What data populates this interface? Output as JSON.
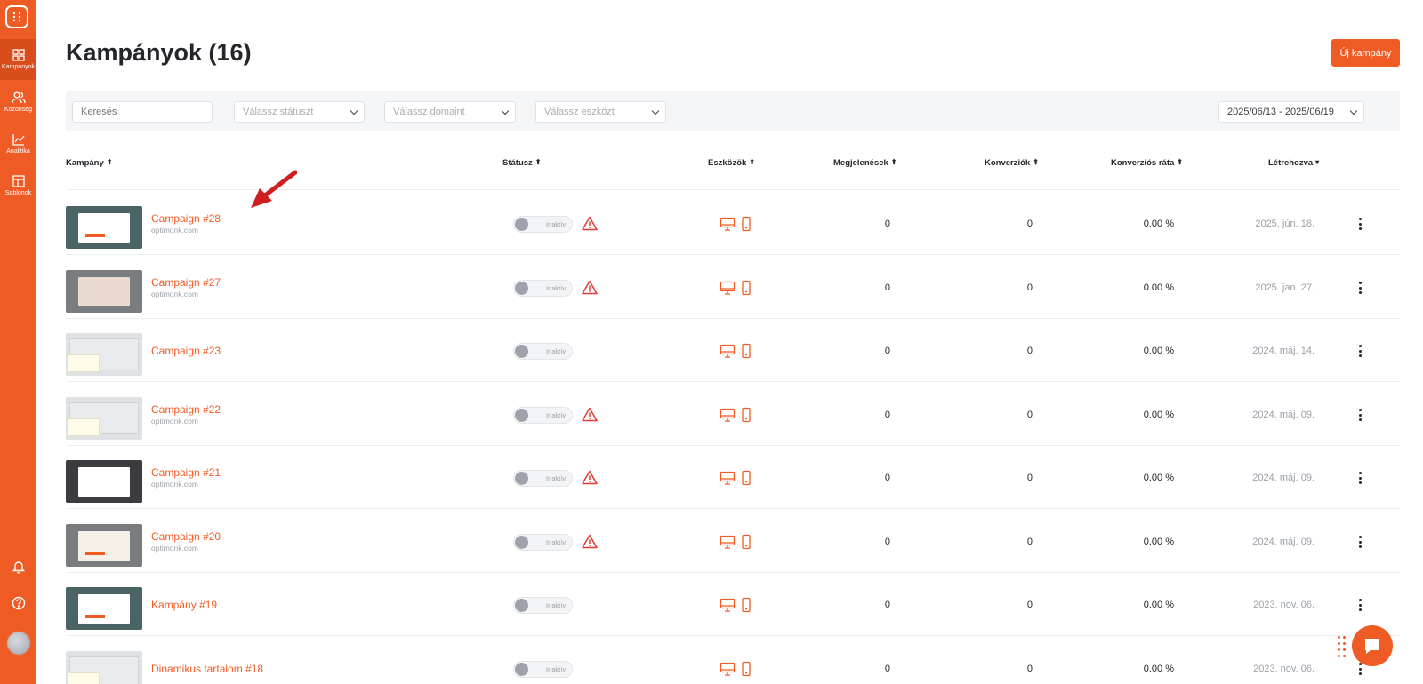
{
  "colors": {
    "brand": "#ef5b25",
    "warning": "#e53935",
    "muted": "#9aa0a8"
  },
  "sidebar": {
    "items": [
      {
        "label": "Kampányok",
        "icon": "grid-icon",
        "active": true
      },
      {
        "label": "Közönség",
        "icon": "users-icon"
      },
      {
        "label": "Analitika",
        "icon": "chart-line-icon"
      },
      {
        "label": "Sablonok",
        "icon": "template-icon"
      }
    ],
    "bottom": [
      "bell-icon",
      "help-icon",
      "avatar"
    ]
  },
  "header": {
    "title": "Kampányok (16)",
    "new_campaign": "Új kampány"
  },
  "filters": {
    "search_placeholder": "Keresés",
    "status_placeholder": "Válassz státuszt",
    "domain_placeholder": "Válassz domaint",
    "device_placeholder": "Válassz eszközt",
    "date_range": "2025/06/13 - 2025/06/19"
  },
  "table": {
    "columns": [
      "Kampány",
      "Státusz",
      "Eszközök",
      "Megjelenések",
      "Konverziók",
      "Konverziós ráta",
      "Létrehozva"
    ],
    "rows": [
      {
        "name": "Campaign #28",
        "domain": "optimonk.com",
        "status": "Inaktív",
        "warning": true,
        "impressions": "0",
        "conversions": "0",
        "rate": "0.00 %",
        "created": "2025. jún. 18."
      },
      {
        "name": "Campaign #27",
        "domain": "optimonk.com",
        "status": "Inaktív",
        "warning": true,
        "impressions": "0",
        "conversions": "0",
        "rate": "0.00 %",
        "created": "2025. jan. 27."
      },
      {
        "name": "Campaign #23",
        "domain": "",
        "status": "Inaktív",
        "warning": false,
        "impressions": "0",
        "conversions": "0",
        "rate": "0.00 %",
        "created": "2024. máj. 14."
      },
      {
        "name": "Campaign #22",
        "domain": "optimonk.com",
        "status": "Inaktív",
        "warning": true,
        "impressions": "0",
        "conversions": "0",
        "rate": "0.00 %",
        "created": "2024. máj. 09."
      },
      {
        "name": "Campaign #21",
        "domain": "optimonk.com",
        "status": "Inaktív",
        "warning": true,
        "impressions": "0",
        "conversions": "0",
        "rate": "0.00 %",
        "created": "2024. máj. 09."
      },
      {
        "name": "Campaign #20",
        "domain": "optimonk.com",
        "status": "Inaktív",
        "warning": true,
        "impressions": "0",
        "conversions": "0",
        "rate": "0.00 %",
        "created": "2024. máj. 09."
      },
      {
        "name": "Kampány #19",
        "domain": "",
        "status": "Inaktív",
        "warning": false,
        "impressions": "0",
        "conversions": "0",
        "rate": "0.00 %",
        "created": "2023. nov. 06."
      },
      {
        "name": "Dinamikus tartalom #18",
        "domain": "",
        "status": "Inaktív",
        "warning": false,
        "impressions": "0",
        "conversions": "0",
        "rate": "0.00 %",
        "created": "2023. nov. 06."
      }
    ]
  }
}
